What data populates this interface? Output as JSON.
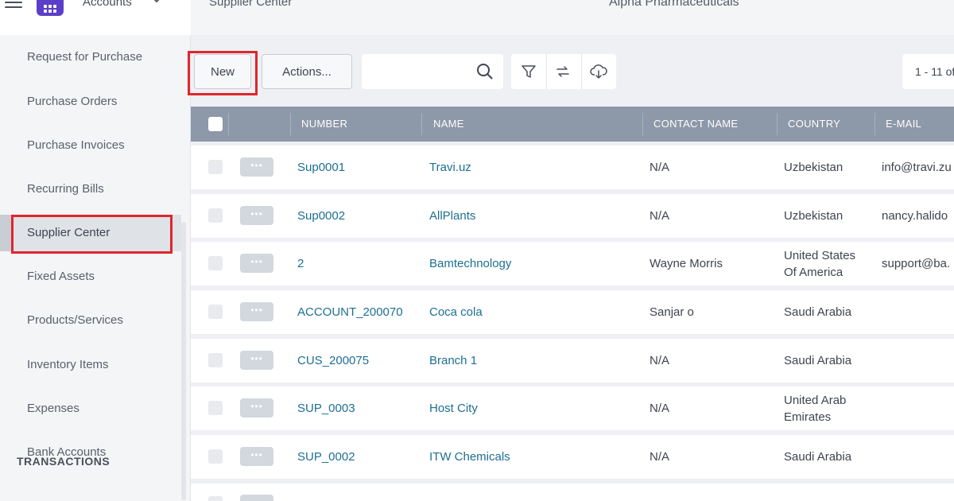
{
  "header": {
    "app_title": "Accounts",
    "breadcrumb": "Supplier Center",
    "company": "Alpha Pharmaceuticals"
  },
  "sidebar": {
    "items": [
      {
        "label": "Request for Purchase"
      },
      {
        "label": "Purchase Orders"
      },
      {
        "label": "Purchase Invoices"
      },
      {
        "label": "Recurring Bills"
      },
      {
        "label": "Supplier Center"
      },
      {
        "label": "Fixed Assets"
      },
      {
        "label": "Products/Services"
      },
      {
        "label": "Inventory Items"
      },
      {
        "label": "Expenses"
      },
      {
        "label": "Bank Accounts"
      }
    ],
    "active_index": 4,
    "section_label": "TRANSACTIONS"
  },
  "toolbar": {
    "new_label": "New",
    "actions_label": "Actions...",
    "search_placeholder": "",
    "pager_text": "1 - 11 of"
  },
  "table": {
    "columns": [
      "NUMBER",
      "NAME",
      "CONTACT NAME",
      "COUNTRY",
      "E-MAIL"
    ],
    "rows": [
      {
        "number": "Sup0001",
        "name": "Travi.uz",
        "contact": "N/A",
        "country": "Uzbekistan",
        "email": "info@travi.zu"
      },
      {
        "number": "Sup0002",
        "name": "AllPlants",
        "contact": "N/A",
        "country": "Uzbekistan",
        "email": "nancy.halido"
      },
      {
        "number": "2",
        "name": "Bamtechnology",
        "contact": "Wayne Morris",
        "country": "United States Of America",
        "email": "support@ba."
      },
      {
        "number": "ACCOUNT_200070",
        "name": "Coca cola",
        "contact": "Sanjar o",
        "country": "Saudi Arabia",
        "email": ""
      },
      {
        "number": "CUS_200075",
        "name": "Branch 1",
        "contact": "N/A",
        "country": "Saudi Arabia",
        "email": ""
      },
      {
        "number": "SUP_0003",
        "name": "Host City",
        "contact": "N/A",
        "country": "United Arab Emirates",
        "email": ""
      },
      {
        "number": "SUP_0002",
        "name": "ITW Chemicals",
        "contact": "N/A",
        "country": "Saudi Arabia",
        "email": ""
      }
    ],
    "row_menu_glyph": "•••"
  },
  "icons": {
    "menu": "hamburger-icon",
    "logo": "app-grid-logo-icon",
    "dropdown": "chevron-down-icon",
    "search": "search-icon",
    "filter": "filter-icon",
    "refresh": "swap-arrows-icon",
    "download": "cloud-download-icon"
  },
  "colors": {
    "accent": "#5b3fc8",
    "link": "#1d6f93",
    "table_header": "#8d98a8",
    "highlight": "#e0262b"
  }
}
